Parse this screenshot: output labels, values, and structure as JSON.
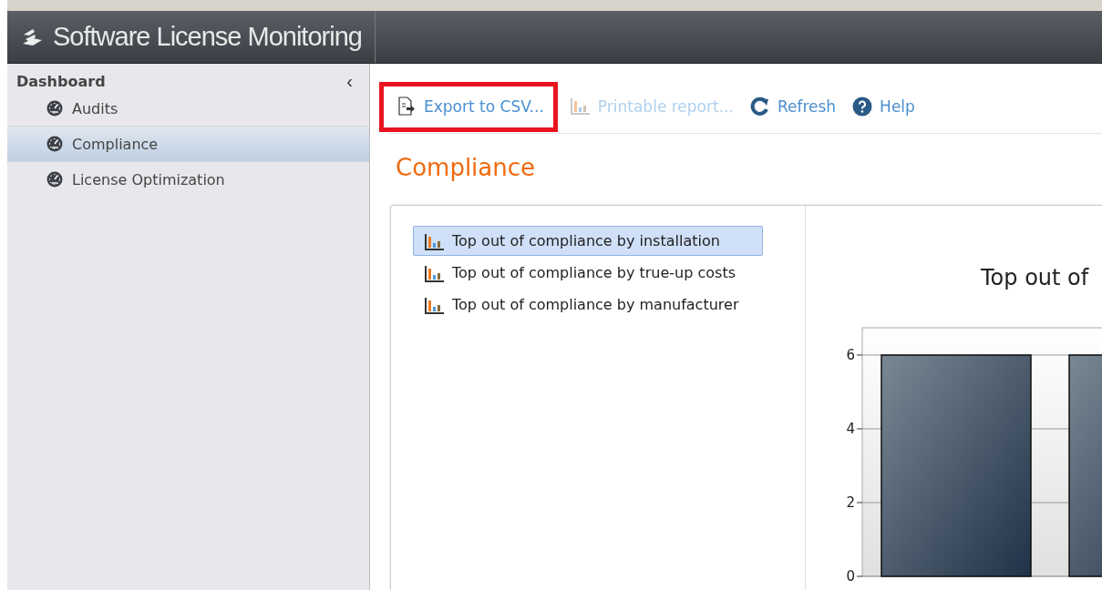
{
  "app": {
    "title": "Software License Monitoring"
  },
  "sidebar": {
    "heading": "Dashboard",
    "collapse": "‹",
    "items": [
      {
        "label": "Audits",
        "selected": false
      },
      {
        "label": "Compliance",
        "selected": true
      },
      {
        "label": "License Optimization",
        "selected": false
      }
    ]
  },
  "toolbar": [
    {
      "label": "Export to CSV...",
      "kind": "export",
      "disabled": false,
      "highlighted": true
    },
    {
      "label": "Printable report...",
      "kind": "report",
      "disabled": true,
      "highlighted": false
    },
    {
      "label": "Refresh",
      "kind": "refresh",
      "disabled": false,
      "highlighted": false
    },
    {
      "label": "Help",
      "kind": "help",
      "disabled": false,
      "highlighted": false
    }
  ],
  "page_title": "Compliance",
  "reports": [
    {
      "label": "Top out of compliance by installation",
      "selected": true
    },
    {
      "label": "Top out of compliance by true-up costs",
      "selected": false
    },
    {
      "label": "Top out of compliance by manufacturer",
      "selected": false
    }
  ],
  "chart": {
    "chart_data": {
      "type": "bar",
      "title": "Top out of",
      "values": [
        6,
        6
      ],
      "ylim": [
        0,
        6.74
      ],
      "yticks": [
        0,
        2,
        4,
        6
      ],
      "grid": true
    }
  }
}
